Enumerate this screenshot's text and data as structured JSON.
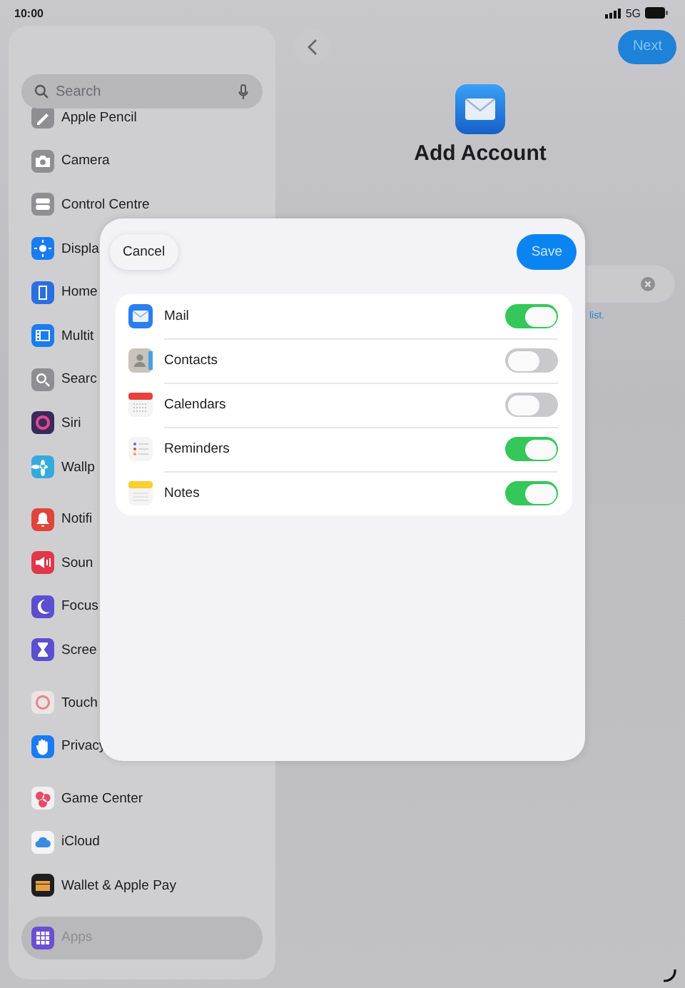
{
  "status_bar": {
    "time": "10:00",
    "network": "5G"
  },
  "sidebar": {
    "search": {
      "placeholder": "Search"
    },
    "groups": [
      {
        "items": [
          {
            "label": "Apple Pencil",
            "color": "#8e8e93",
            "selected": false
          },
          {
            "label": "Camera",
            "color": "#8e8e93",
            "selected": false
          },
          {
            "label": "Control Centre",
            "color": "#8e8e93",
            "selected": false
          },
          {
            "label": "Displa",
            "color": "#1a7cf0",
            "selected": false
          },
          {
            "label": "Home",
            "color": "#2a6fe0",
            "selected": false
          },
          {
            "label": "Multit",
            "color": "#1a7cf0",
            "selected": false
          },
          {
            "label": "Searc",
            "color": "#8e8e93",
            "selected": false
          },
          {
            "label": "Siri",
            "color": "#3a2a5a",
            "selected": false
          },
          {
            "label": "Wallp",
            "color": "#35aadc",
            "selected": false
          }
        ]
      },
      {
        "items": [
          {
            "label": "Notifi",
            "color": "#e0443a",
            "selected": false
          },
          {
            "label": "Soun",
            "color": "#e0384a",
            "selected": false
          },
          {
            "label": "Focus",
            "color": "#5b4fcf",
            "selected": false
          },
          {
            "label": "Scree",
            "color": "#5b4fcf",
            "selected": false
          }
        ]
      },
      {
        "items": [
          {
            "label": "Touch",
            "color": "#ece4e4",
            "selected": false
          },
          {
            "label": "Privacy",
            "color": "#1a7cf0",
            "selected": false
          }
        ]
      },
      {
        "items": [
          {
            "label": "Game Center",
            "color": "#f0f0f0",
            "selected": false
          },
          {
            "label": "iCloud",
            "color": "#f4f4f6",
            "selected": false
          },
          {
            "label": "Wallet & Apple Pay",
            "color": "#1e1e20",
            "selected": false
          }
        ]
      },
      {
        "items": [
          {
            "label": "Apps",
            "color": "#6a4fd0",
            "selected": true
          }
        ]
      }
    ]
  },
  "header": {
    "next": "Next",
    "title": "Add Account",
    "hint": "list."
  },
  "sheet": {
    "cancel": "Cancel",
    "save": "Save",
    "apps": [
      {
        "label": "Mail",
        "on": true
      },
      {
        "label": "Contacts",
        "on": false
      },
      {
        "label": "Calendars",
        "on": false
      },
      {
        "label": "Reminders",
        "on": true
      },
      {
        "label": "Notes",
        "on": true
      }
    ]
  }
}
